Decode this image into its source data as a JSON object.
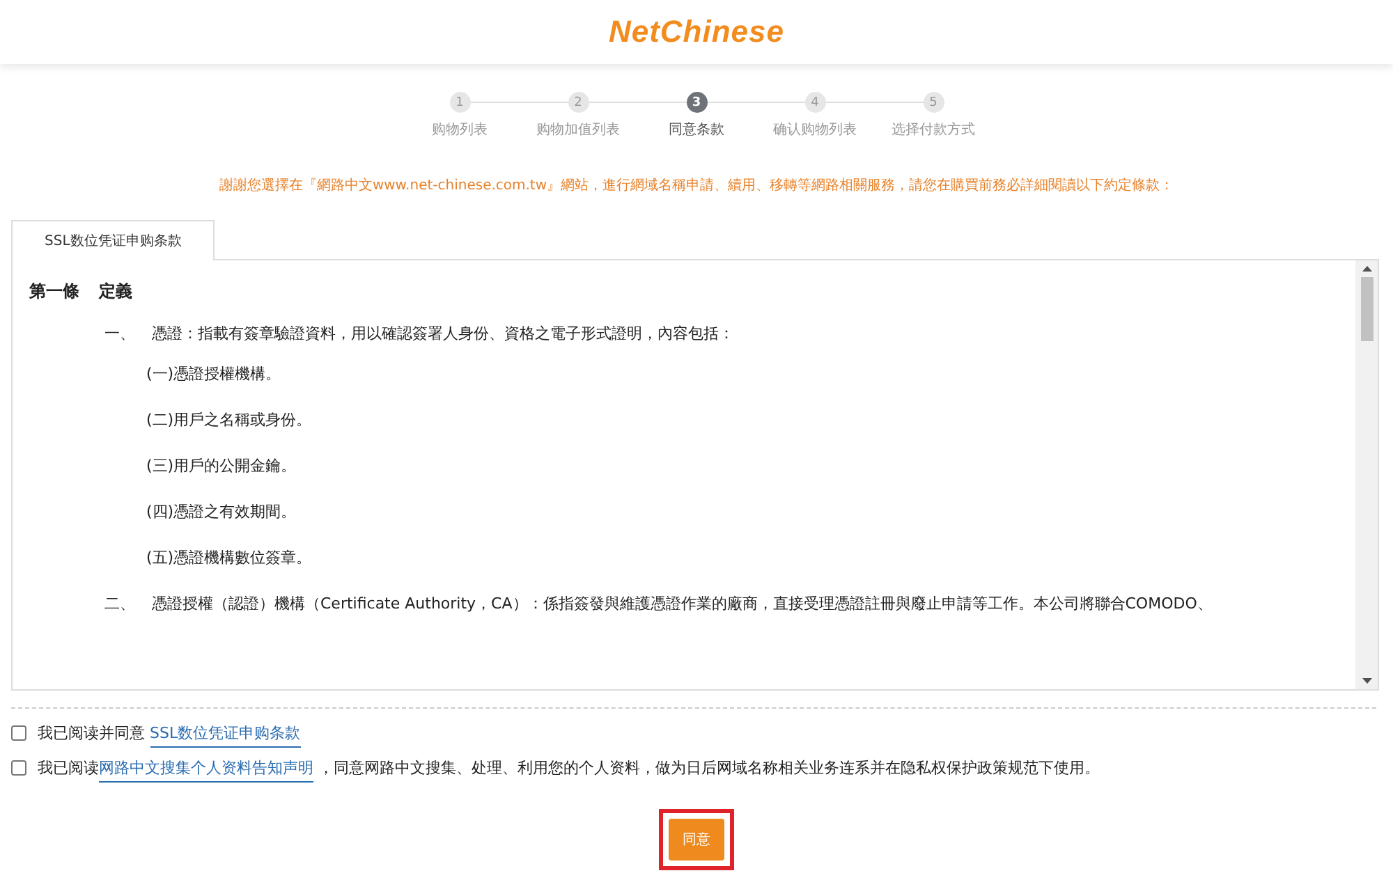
{
  "header": {
    "logo": "NetChinese"
  },
  "steps": [
    {
      "number": "1",
      "label": "购物列表",
      "selected": false
    },
    {
      "number": "2",
      "label": "购物加值列表",
      "selected": false
    },
    {
      "number": "3",
      "label": "同意条款",
      "selected": true
    },
    {
      "number": "4",
      "label": "确认购物列表",
      "selected": false
    },
    {
      "number": "5",
      "label": "选择付款方式",
      "selected": false
    }
  ],
  "notice": "謝謝您選擇在『網路中文www.net-chinese.com.tw』網站，進行網域名稱申請、續用、移轉等網路相關服務，請您在購買前務必詳細閱讀以下約定條款：",
  "tabs": [
    {
      "label": "SSL数位凭证申购条款",
      "selected": true
    }
  ],
  "terms": {
    "article_number": "第一條",
    "article_title": "定義",
    "clauses": [
      {
        "number": "一、",
        "text": "憑證：指載有簽章驗證資料，用以確認簽署人身份、資格之電子形式證明，內容包括：",
        "items": [
          "(一)憑證授權機構。",
          "(二)用戶之名稱或身份。",
          "(三)用戶的公開金鑰。",
          "(四)憑證之有效期間。",
          "(五)憑證機構數位簽章。"
        ]
      },
      {
        "number": "二、",
        "text": "憑證授權（認證）機構（Certificate Authority，CA）：係指簽發與維護憑證作業的廠商，直接受理憑證註冊與廢止申請等工作。本公司將聯合COMODO、"
      }
    ]
  },
  "agreements": [
    {
      "checked": false,
      "before": "我已阅读并同意 ",
      "link": "SSL数位凭证申购条款"
    },
    {
      "checked": false,
      "before": "我已阅读",
      "link": "网路中文搜集个人资料告知声明",
      "after": " ，同意网路中文搜集、处理、利用您的个人资料，做为日后网域名称相关业务连系并在隐私权保护政策规范下使用。"
    }
  ],
  "agree_button": {
    "label": "同意",
    "highlighted": true
  }
}
